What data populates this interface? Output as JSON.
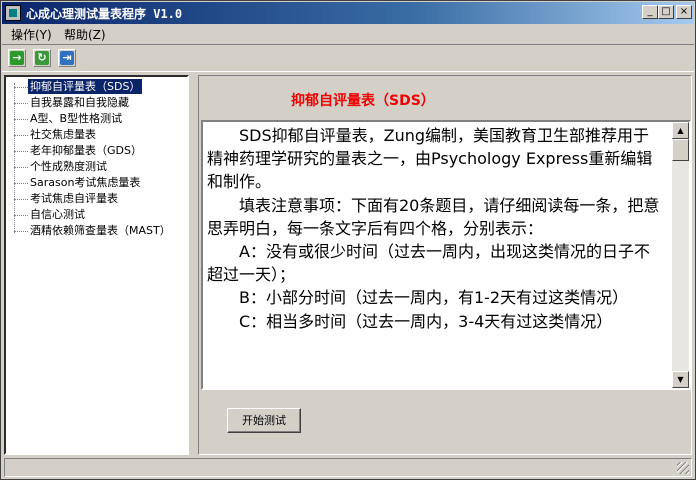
{
  "window": {
    "title": "心成心理测试量表程序  V1.0"
  },
  "titlebar_buttons": {
    "minimize": "_",
    "maximize": "□",
    "close": "×"
  },
  "menu": [
    {
      "label": "操作(Y)"
    },
    {
      "label": "帮助(Z)"
    }
  ],
  "toolbar": [
    {
      "icon": "green-right-arrow-icon",
      "color": "#2a9a2a",
      "glyph": "→"
    },
    {
      "icon": "green-refresh-icon",
      "color": "#3a9a3a",
      "glyph": "↻"
    },
    {
      "icon": "exit-door-icon",
      "color": "#3070c0",
      "glyph": "⇥"
    }
  ],
  "tree": {
    "items": [
      {
        "label": "抑郁自评量表（SDS）",
        "selected": true
      },
      {
        "label": "自我暴露和自我隐藏"
      },
      {
        "label": "A型、B型性格测试"
      },
      {
        "label": "社交焦虑量表"
      },
      {
        "label": "老年抑郁量表（GDS）"
      },
      {
        "label": "个性成熟度测试"
      },
      {
        "label": "Sarason考试焦虑量表"
      },
      {
        "label": "考试焦虑自评量表"
      },
      {
        "label": "自信心测试"
      },
      {
        "label": "酒精依赖筛查量表（MAST）"
      }
    ]
  },
  "panel": {
    "title": "抑郁自评量表（SDS）",
    "title_color": "#f00000",
    "paragraphs": [
      "SDS抑郁自评量表，Zung编制，美国教育卫生部推荐用于精神药理学研究的量表之一，由Psychology Express重新编辑和制作。",
      "填表注意事项：下面有20条题目，请仔细阅读每一条，把意思弄明白，每一条文字后有四个格，分别表示：",
      "A：没有或很少时间（过去一周内，出现这类情况的日子不超过一天）；",
      "B：小部分时间（过去一周内，有1-2天有过这类情况）",
      "C：相当多时间（过去一周内，3-4天有过这类情况）"
    ],
    "start_button": "开始测试"
  },
  "colors": {
    "window_bg": "#d4d0c8",
    "title_start": "#0a246a",
    "title_end": "#a6caf0",
    "selection": "#0a246a"
  }
}
